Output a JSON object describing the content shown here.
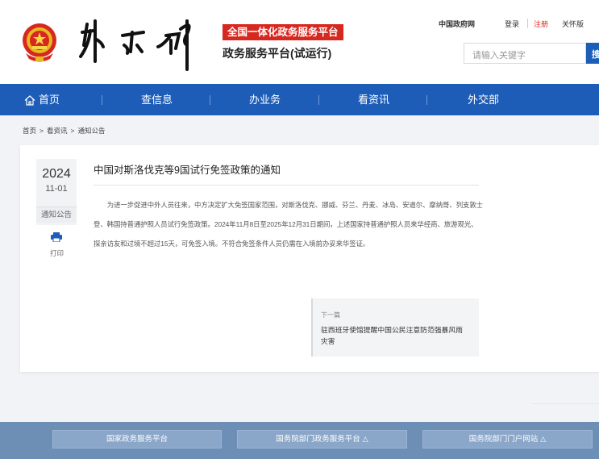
{
  "header": {
    "badge_text": "全国一体化政务服务平台",
    "subtitle": "政务服务平台(试运行)",
    "links": {
      "gov": "中国政府网",
      "login": "登录",
      "register": "注册",
      "care": "关怀版"
    },
    "search": {
      "placeholder": "请输入关键字",
      "button_label": "搜索"
    },
    "emblem_icon": "national-emblem-icon",
    "logo_calligraphy": "外交部"
  },
  "nav": {
    "items": [
      "首页",
      "查信息",
      "办业务",
      "看资讯",
      "外交部"
    ],
    "home_icon": "home-icon",
    "color": "#1e5db7"
  },
  "breadcrumb": {
    "items": [
      "首页",
      ">",
      "看资讯",
      ">",
      "通知公告"
    ]
  },
  "article": {
    "year": "2024",
    "month_day": "11-01",
    "category": "通知公告",
    "print_label": "打印",
    "title": "中国对斯洛伐克等9国试行免签政策的通知",
    "body": "为进一步促进中外人员往来，中方决定扩大免签国家范围，对斯洛伐克、挪威、芬兰、丹麦、冰岛、安道尔、摩纳哥、列支敦士登、韩国持普通护照人员试行免签政策。2024年11月8日至2025年12月31日期间，上述国家持普通护照人员来华经商、旅游观光、探亲访友和过境不超过15天，可免签入境。不符合免签条件人员仍需在入境前办妥来华签证。",
    "next_label": "下一篇",
    "next_title": "驻西班牙使馆提醒中国公民注意防范强暴风雨灾害"
  },
  "footer": {
    "buttons": [
      "国家政务服务平台",
      "国务院部门政务服务平台",
      "国务院部门门户网站"
    ],
    "color": "#6e8fb5"
  }
}
